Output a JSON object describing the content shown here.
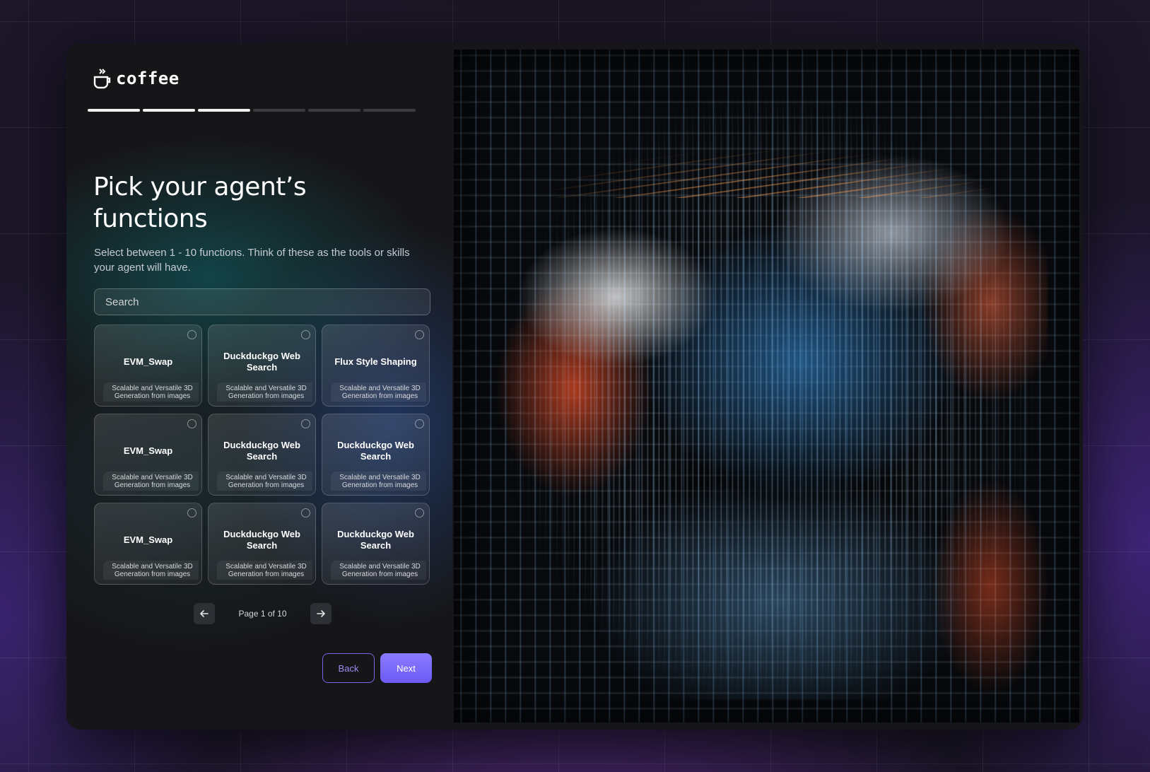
{
  "brand": {
    "name": "coffee",
    "icon": "coffee-cup-icon"
  },
  "progress": {
    "total_steps": 6,
    "completed_steps": 3
  },
  "heading": {
    "title": "Pick your agent’s functions",
    "subtitle": "Select between 1 - 10 functions. Think of these as the tools or skills your agent will have."
  },
  "search": {
    "placeholder": "Search",
    "value": ""
  },
  "functions": [
    {
      "name": "EVM_Swap",
      "description": "Scalable and Versatile 3D Generation from images",
      "selected": false
    },
    {
      "name": "Duckduckgo Web Search",
      "description": "Scalable and Versatile 3D Generation from images",
      "selected": false
    },
    {
      "name": "Flux Style Shaping",
      "description": "Scalable and Versatile 3D Generation from images",
      "selected": false
    },
    {
      "name": "EVM_Swap",
      "description": "Scalable and Versatile 3D Generation from images",
      "selected": false
    },
    {
      "name": "Duckduckgo Web Search",
      "description": "Scalable and Versatile 3D Generation from images",
      "selected": false
    },
    {
      "name": "Duckduckgo Web Search",
      "description": "Scalable and Versatile 3D Generation from images",
      "selected": false
    },
    {
      "name": "EVM_Swap",
      "description": "Scalable and Versatile 3D Generation from images",
      "selected": false
    },
    {
      "name": "Duckduckgo Web Search",
      "description": "Scalable and Versatile 3D Generation from images",
      "selected": false
    },
    {
      "name": "Duckduckgo Web Search",
      "description": "Scalable and Versatile 3D Generation from images",
      "selected": false
    }
  ],
  "pagination": {
    "label": "Page 1 of 10",
    "prev_icon": "arrow-left-icon",
    "next_icon": "arrow-right-icon"
  },
  "actions": {
    "back_label": "Back",
    "next_label": "Next"
  },
  "colors": {
    "accent": "#7a63e8",
    "next_button": "#7b6bfb",
    "panel_bg": "#161618",
    "page_bg": "#1b1628"
  }
}
